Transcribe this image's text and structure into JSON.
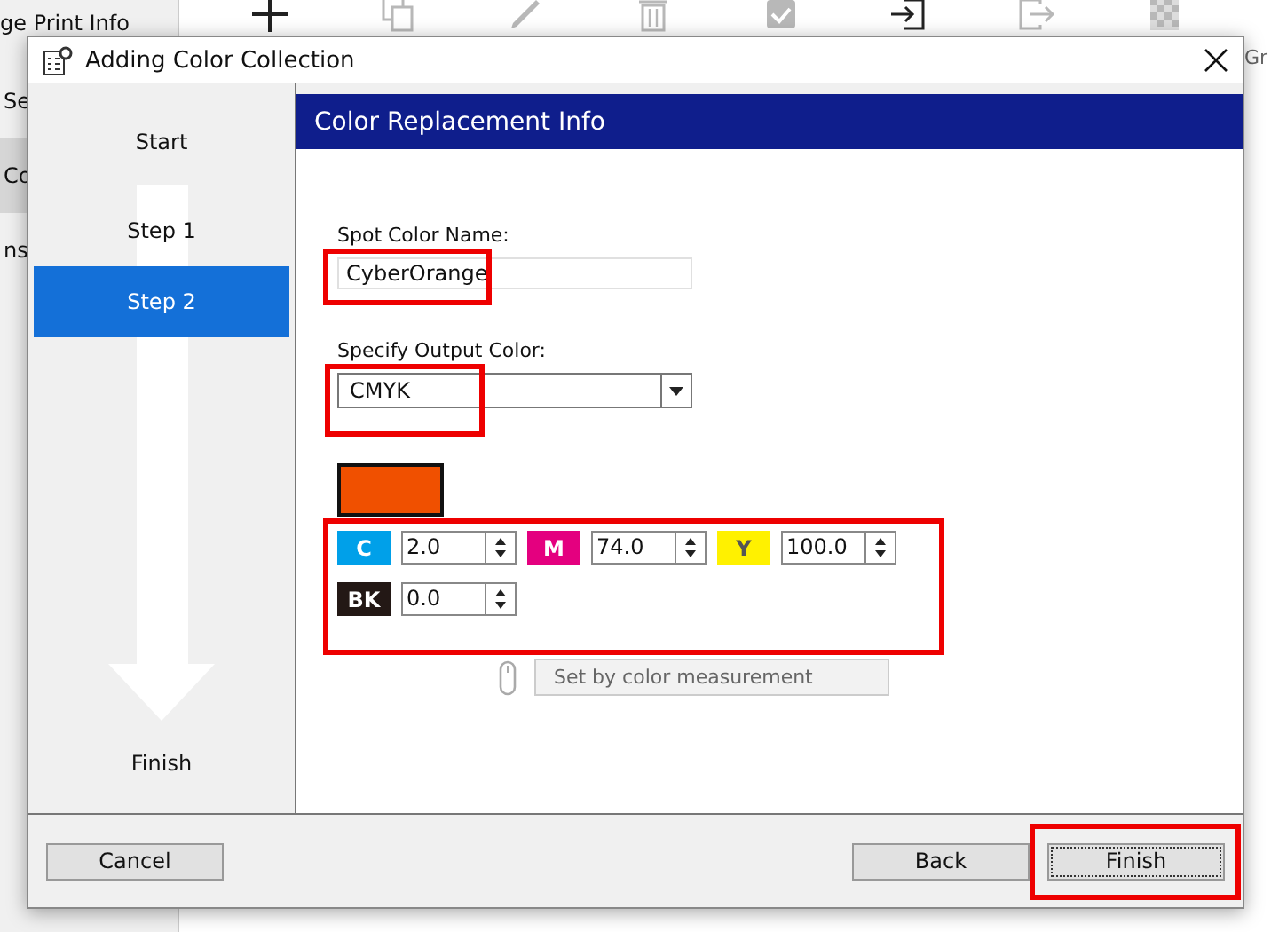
{
  "background_app": {
    "sidebar_items": [
      {
        "label": "ge Print Info",
        "selected": false
      },
      {
        "label": "Se",
        "selected": false
      },
      {
        "label": "Co",
        "selected": true
      },
      {
        "label": "ns",
        "selected": false
      }
    ],
    "toolbar": [
      {
        "kind": "add",
        "disabled": false
      },
      {
        "kind": "copy",
        "disabled": true
      },
      {
        "kind": "edit",
        "disabled": true
      },
      {
        "kind": "delete",
        "disabled": true
      },
      {
        "kind": "check",
        "disabled": true
      },
      {
        "kind": "import",
        "disabled": false
      },
      {
        "kind": "export",
        "disabled": true
      },
      {
        "kind": "pattern",
        "disabled": true
      }
    ],
    "right_label": "Gr"
  },
  "window": {
    "title": "Adding Color Collection"
  },
  "steps": [
    {
      "label": "Start",
      "selected": false
    },
    {
      "label": "Step 1",
      "selected": false
    },
    {
      "label": "Step 2",
      "selected": true
    },
    {
      "label": "Finish",
      "selected": false
    }
  ],
  "panel": {
    "header": "Color Replacement Info",
    "spot_name": {
      "label": "Spot Color Name:",
      "value": "CyberOrange"
    },
    "output_color": {
      "label": "Specify Output Color:",
      "value": "CMYK"
    },
    "swatch": {
      "color": "#f05000"
    },
    "channels": [
      {
        "label": "C",
        "value": "2.0",
        "color": "#00a0e9"
      },
      {
        "label": "M",
        "value": "74.0",
        "color": "#e4007f"
      },
      {
        "label": "Y",
        "value": "100.0",
        "color": "#fff100"
      },
      {
        "label": "BK",
        "value": "0.0",
        "color": "#231815"
      }
    ],
    "measure_button": {
      "label": "Set by color measurement",
      "disabled": true
    }
  },
  "buttons": [
    {
      "label": "Cancel",
      "focused": false
    },
    {
      "label": "Back",
      "focused": false
    },
    {
      "label": "Finish",
      "focused": true
    }
  ]
}
